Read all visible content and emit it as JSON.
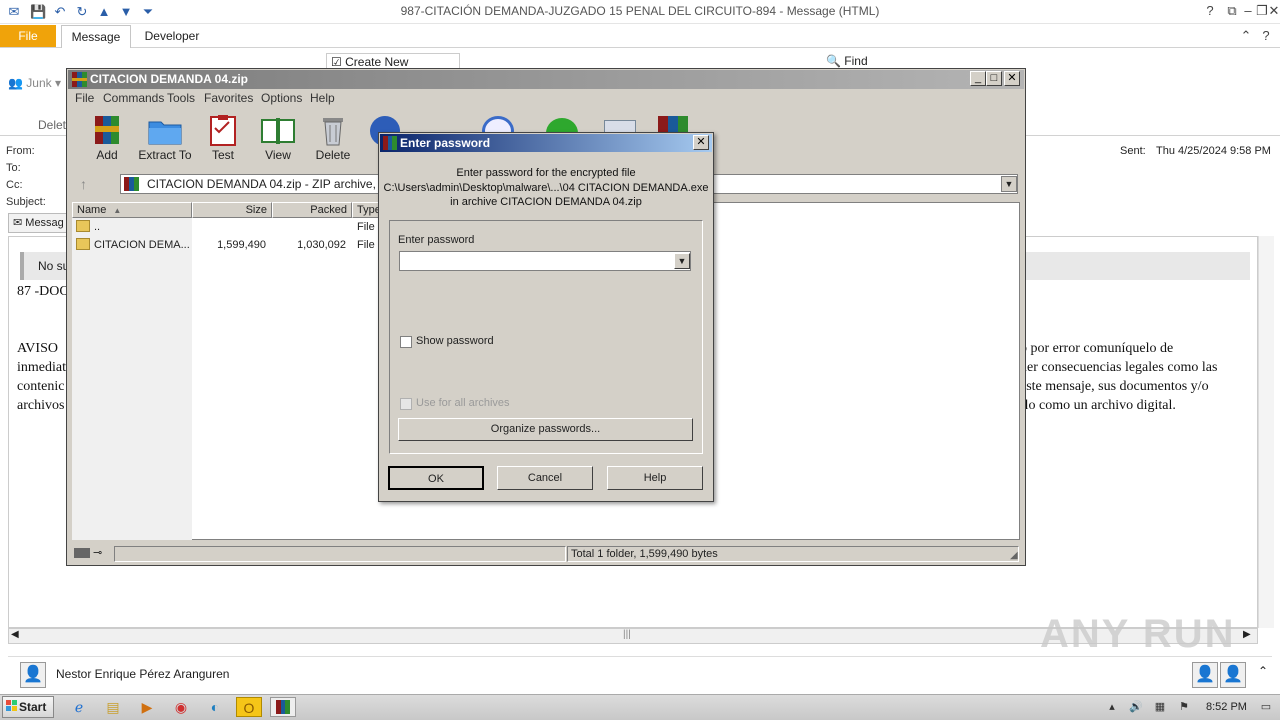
{
  "outlook": {
    "window_title": "987-CITACIÓN  DEMANDA-JUZGADO 15 PENAL DEL CIRCUITO-894  -  Message (HTML)",
    "tabs": [
      {
        "label": "File"
      },
      {
        "label": "Message"
      },
      {
        "label": "Developer"
      }
    ],
    "ribbon": {
      "junk_label": "Junk",
      "delete_label": "Delet",
      "create_new_label": "Create New",
      "find_label": "Find"
    },
    "header": {
      "from_label": "From:",
      "to_label": "To:",
      "cc_label": "Cc:",
      "subject_label": "Subject:",
      "sent_label": "Sent:",
      "sent_value": "Thu 4/25/2024 9:58 PM"
    },
    "message_tab_label": "Messag",
    "body": {
      "notice": "No su",
      "line1": "87 -DOC",
      "aviso_left": [
        "AVISO",
        "inmediat",
        "contenic",
        "archivos"
      ],
      "aviso_right": [
        "ó por error comuníquelo de",
        "ner consecuencias legales como las",
        "este mensaje, sus documentos y/o",
        "rlo como un archivo digital."
      ]
    },
    "sender_name": "Nestor Enrique Pérez Aranguren"
  },
  "winrar": {
    "title": "CITACION DEMANDA 04.zip",
    "menu": [
      "File",
      "Commands",
      "Tools",
      "Favorites",
      "Options",
      "Help"
    ],
    "toolbar": [
      {
        "label": "Add",
        "icon": "add-archive-icon"
      },
      {
        "label": "Extract To",
        "icon": "extract-folder-icon"
      },
      {
        "label": "Test",
        "icon": "test-clipboard-icon"
      },
      {
        "label": "View",
        "icon": "view-book-icon"
      },
      {
        "label": "Delete",
        "icon": "delete-trash-icon"
      }
    ],
    "address": "CITACION DEMANDA 04.zip - ZIP archive, unpac",
    "columns": [
      "Name",
      "Size",
      "Packed",
      "Type"
    ],
    "rows": [
      {
        "name": "..",
        "size": "",
        "packed": "",
        "type": "File"
      },
      {
        "name": "CITACION DEMA...",
        "size": "1,599,490",
        "packed": "1,030,092",
        "type": "File"
      }
    ],
    "status": "Total 1 folder, 1,599,490 bytes"
  },
  "password_dialog": {
    "title": "Enter password",
    "info_line1": "Enter password for the encrypted file",
    "info_line2": "C:\\Users\\admin\\Desktop\\malware\\...\\04 CITACION DEMANDA.exe",
    "info_line3": "in archive CITACION DEMANDA 04.zip",
    "enter_password_label": "Enter password",
    "password_value": "",
    "show_password_label": "Show password",
    "use_for_all_label": "Use for all archives",
    "organize_label": "Organize passwords...",
    "ok_label": "OK",
    "cancel_label": "Cancel",
    "help_label": "Help"
  },
  "taskbar": {
    "start_label": "Start",
    "clock": "8:52 PM"
  },
  "watermark": "ANY RUN",
  "colors": {
    "file_tab": "#f0a30a",
    "dialog_title_gradient_start": "#0a246a",
    "dialog_title_gradient_end": "#a6caf0"
  }
}
